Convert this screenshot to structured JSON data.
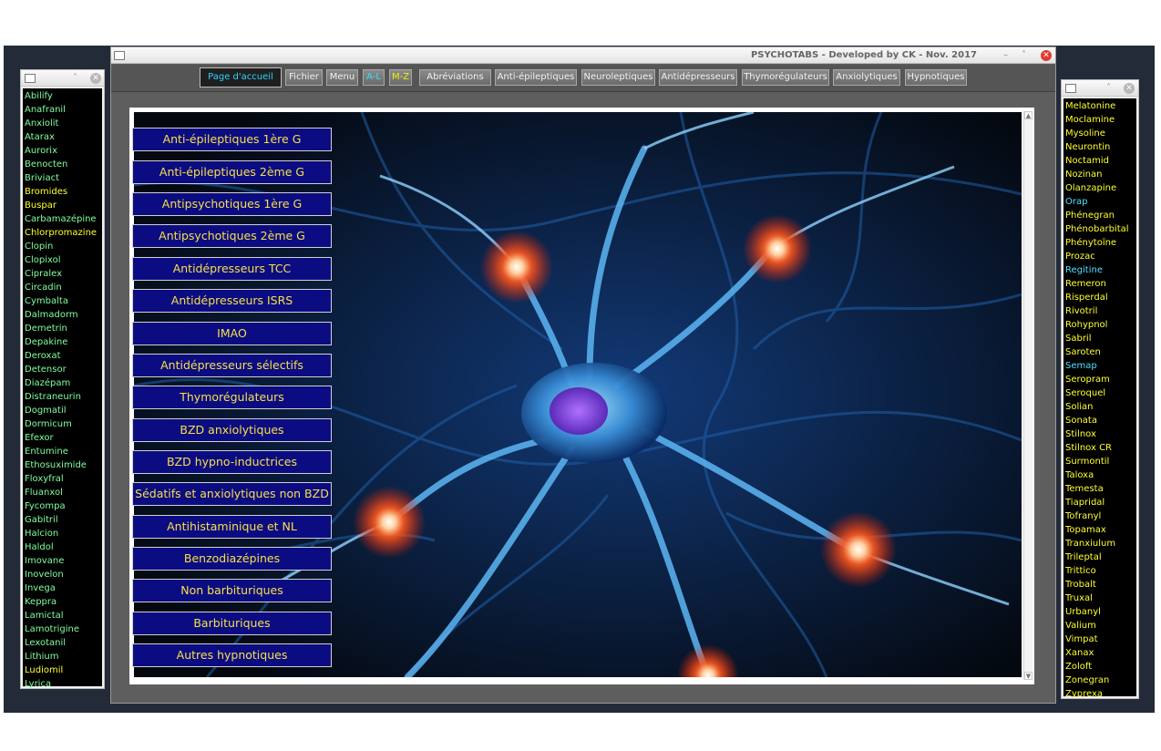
{
  "main_window": {
    "title": "PSYCHOTABS - Developed by CK - Nov. 2017",
    "controls": {
      "minimize": "–",
      "maximize": "˄",
      "close": "✕"
    }
  },
  "toolbar": [
    {
      "label": "Page d'accueil",
      "style": "home"
    },
    {
      "label": "Fichier",
      "style": "normal"
    },
    {
      "label": "Menu",
      "style": "normal"
    },
    {
      "label": "A-L",
      "style": "al"
    },
    {
      "label": "M-Z",
      "style": "mz"
    },
    {
      "label": "Abréviations",
      "style": "normal"
    },
    {
      "label": "Anti-épileptiques",
      "style": "normal"
    },
    {
      "label": "Neuroleptiques",
      "style": "normal"
    },
    {
      "label": "Antidépresseurs",
      "style": "normal"
    },
    {
      "label": "Thymorégulateurs",
      "style": "normal"
    },
    {
      "label": "Anxiolytiques",
      "style": "normal"
    },
    {
      "label": "Hypnotiques",
      "style": "normal"
    }
  ],
  "categories": [
    "Anti-épileptiques 1ère G",
    "Anti-épileptiques 2ème G",
    "Antipsychotiques 1ère G",
    "Antipsychotiques 2ème G",
    "Antidépresseurs TCC",
    "Antidépresseurs ISRS",
    "IMAO",
    "Antidépresseurs sélectifs",
    "Thymorégulateurs",
    "BZD anxiolytiques",
    "BZD hypno-inductrices",
    "Sédatifs et anxiolytiques non BZD",
    "Antihistaminique et NL",
    "Benzodiazépines",
    "Non barbituriques",
    "Barbituriques",
    "Autres hypnotiques"
  ],
  "left_list": {
    "controls": {
      "maximize": "˄",
      "close": "✕"
    },
    "items": [
      {
        "name": "Abilify",
        "color": "green"
      },
      {
        "name": "Anafranil",
        "color": "green"
      },
      {
        "name": "Anxiolit",
        "color": "green"
      },
      {
        "name": "Atarax",
        "color": "green"
      },
      {
        "name": "Aurorix",
        "color": "green"
      },
      {
        "name": "Benocten",
        "color": "green"
      },
      {
        "name": "Briviact",
        "color": "green"
      },
      {
        "name": "Bromides",
        "color": "yellow"
      },
      {
        "name": "Buspar",
        "color": "yellow"
      },
      {
        "name": "Carbamazépine",
        "color": "green"
      },
      {
        "name": "Chlorpromazine",
        "color": "yellow"
      },
      {
        "name": "Clopin",
        "color": "green"
      },
      {
        "name": "Clopixol",
        "color": "green"
      },
      {
        "name": "Cipralex",
        "color": "green"
      },
      {
        "name": "Circadin",
        "color": "green"
      },
      {
        "name": "Cymbalta",
        "color": "green"
      },
      {
        "name": "Dalmadorm",
        "color": "green"
      },
      {
        "name": "Demetrin",
        "color": "green"
      },
      {
        "name": "Depakine",
        "color": "green"
      },
      {
        "name": "Deroxat",
        "color": "green"
      },
      {
        "name": "Detensor",
        "color": "green"
      },
      {
        "name": "Diazépam",
        "color": "green"
      },
      {
        "name": "Distraneurin",
        "color": "green"
      },
      {
        "name": "Dogmatil",
        "color": "green"
      },
      {
        "name": "Dormicum",
        "color": "green"
      },
      {
        "name": "Efexor",
        "color": "green"
      },
      {
        "name": "Entumine",
        "color": "green"
      },
      {
        "name": "Ethosuximide",
        "color": "green"
      },
      {
        "name": "Floxyfral",
        "color": "green"
      },
      {
        "name": "Fluanxol",
        "color": "green"
      },
      {
        "name": "Fycompa",
        "color": "green"
      },
      {
        "name": "Gabitril",
        "color": "green"
      },
      {
        "name": "Halcion",
        "color": "green"
      },
      {
        "name": "Haldol",
        "color": "green"
      },
      {
        "name": "Imovane",
        "color": "green"
      },
      {
        "name": "Inovelon",
        "color": "green"
      },
      {
        "name": "Invega",
        "color": "green"
      },
      {
        "name": "Keppra",
        "color": "green"
      },
      {
        "name": "Lamictal",
        "color": "green"
      },
      {
        "name": "Lamotrigine",
        "color": "green"
      },
      {
        "name": "Lexotanil",
        "color": "green"
      },
      {
        "name": "Lithium",
        "color": "green"
      },
      {
        "name": "Ludiomil",
        "color": "yellow"
      },
      {
        "name": "Lyrica",
        "color": "green"
      }
    ]
  },
  "right_list": {
    "controls": {
      "maximize": "˄",
      "close": "✕"
    },
    "items": [
      {
        "name": "Melatonine",
        "color": "yellow"
      },
      {
        "name": "Moclamine",
        "color": "yellow"
      },
      {
        "name": "Mysoline",
        "color": "yellow"
      },
      {
        "name": "Neurontin",
        "color": "yellow"
      },
      {
        "name": "Noctamid",
        "color": "yellow"
      },
      {
        "name": "Nozinan",
        "color": "yellow"
      },
      {
        "name": "Olanzapine",
        "color": "yellow"
      },
      {
        "name": "Orap",
        "color": "cyan"
      },
      {
        "name": "Phénegran",
        "color": "yellow"
      },
      {
        "name": "Phénobarbital",
        "color": "yellow"
      },
      {
        "name": "Phénytoïne",
        "color": "yellow"
      },
      {
        "name": "Prozac",
        "color": "yellow"
      },
      {
        "name": "Regitine",
        "color": "cyan"
      },
      {
        "name": "Remeron",
        "color": "yellow"
      },
      {
        "name": "Risperdal",
        "color": "yellow"
      },
      {
        "name": "Rivotril",
        "color": "yellow"
      },
      {
        "name": "Rohypnol",
        "color": "yellow"
      },
      {
        "name": "Sabril",
        "color": "yellow"
      },
      {
        "name": "Saroten",
        "color": "yellow"
      },
      {
        "name": "Semap",
        "color": "cyan"
      },
      {
        "name": "Seropram",
        "color": "yellow"
      },
      {
        "name": "Seroquel",
        "color": "yellow"
      },
      {
        "name": "Solian",
        "color": "yellow"
      },
      {
        "name": "Sonata",
        "color": "yellow"
      },
      {
        "name": "Stilnox",
        "color": "yellow"
      },
      {
        "name": "Stilnox CR",
        "color": "yellow"
      },
      {
        "name": "Surmontil",
        "color": "yellow"
      },
      {
        "name": "Taloxa",
        "color": "yellow"
      },
      {
        "name": "Temesta",
        "color": "yellow"
      },
      {
        "name": "Tiapridal",
        "color": "yellow"
      },
      {
        "name": "Tofranyl",
        "color": "yellow"
      },
      {
        "name": "Topamax",
        "color": "yellow"
      },
      {
        "name": "Tranxiulum",
        "color": "yellow"
      },
      {
        "name": "Trileptal",
        "color": "yellow"
      },
      {
        "name": "Trittico",
        "color": "yellow"
      },
      {
        "name": "Trobalt",
        "color": "yellow"
      },
      {
        "name": "Truxal",
        "color": "yellow"
      },
      {
        "name": "Urbanyl",
        "color": "yellow"
      },
      {
        "name": "Valium",
        "color": "yellow"
      },
      {
        "name": "Vimpat",
        "color": "yellow"
      },
      {
        "name": "Xanax",
        "color": "yellow"
      },
      {
        "name": "Zoloft",
        "color": "yellow"
      },
      {
        "name": "Zonegran",
        "color": "yellow"
      },
      {
        "name": "Zyprexa",
        "color": "yellow"
      }
    ]
  },
  "colors": {
    "category_button_bg": "#0c0c82",
    "category_button_text": "#f5e04a",
    "list_green": "#7fffa0",
    "list_yellow": "#ffff33",
    "list_cyan": "#4fe0ff",
    "home_button_text": "#30d2ff"
  },
  "background_image": "neuron-network-illustration"
}
